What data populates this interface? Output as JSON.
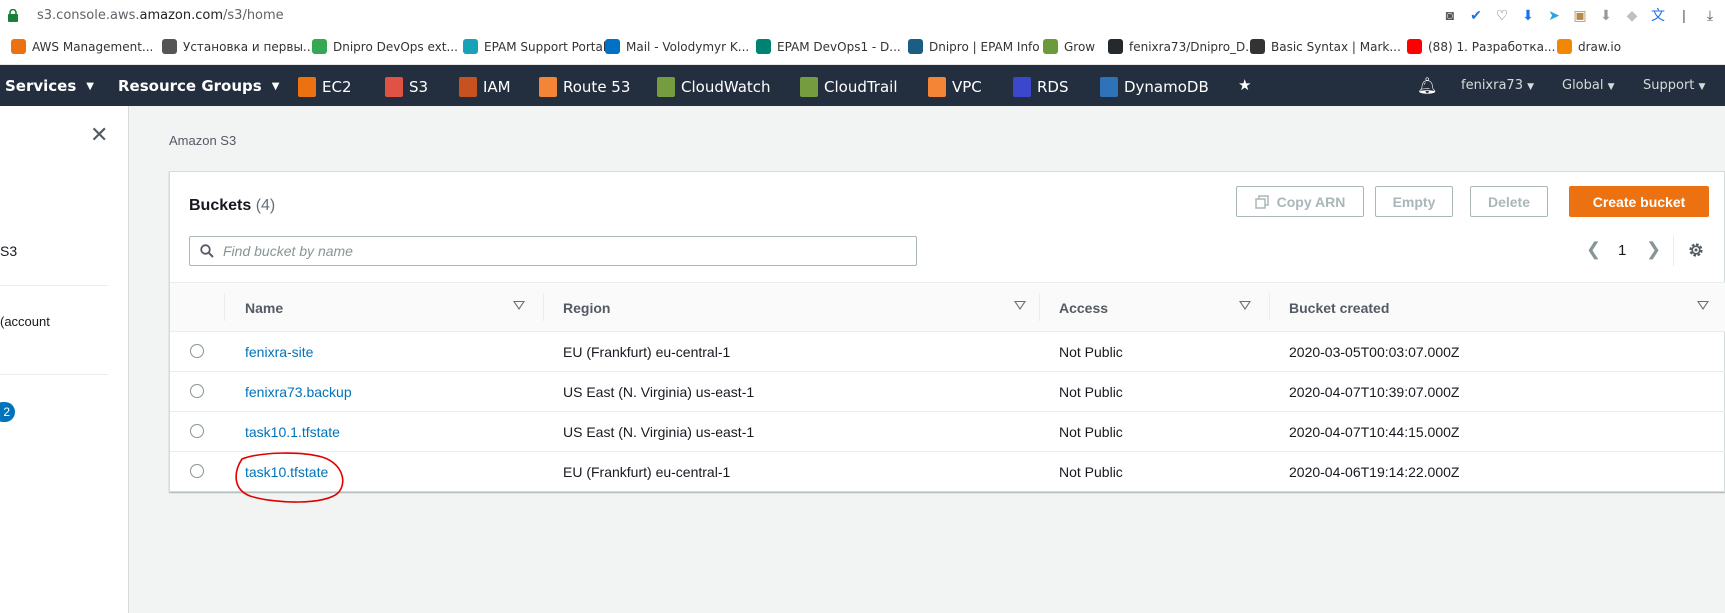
{
  "browser": {
    "url_prefix": "s3.console.aws.",
    "url_domain": "amazon.com",
    "url_path": "/s3/home"
  },
  "bookmarks": [
    {
      "label": "AWS Management...",
      "color": "#ec7211"
    },
    {
      "label": "Установка и первы...",
      "color": "#555555"
    },
    {
      "label": "Dnipro DevOps ext...",
      "color": "#34a853"
    },
    {
      "label": "EPAM Support Portal",
      "color": "#17a2b8"
    },
    {
      "label": "Mail - Volodymyr K...",
      "color": "#0072c6"
    },
    {
      "label": "EPAM DevOps1 - D...",
      "color": "#008272"
    },
    {
      "label": "Dnipro | EPAM Info",
      "color": "#1b5e85"
    },
    {
      "label": "Grow",
      "color": "#6a9a3a"
    },
    {
      "label": "fenixra73/Dnipro_D...",
      "color": "#24292e"
    },
    {
      "label": "Basic Syntax | Mark...",
      "color": "#333333"
    },
    {
      "label": "(88) 1. Разработка...",
      "color": "#ff0000"
    },
    {
      "label": "draw.io",
      "color": "#f08705"
    }
  ],
  "nav": {
    "services": "Services",
    "resource_groups": "Resource Groups",
    "items": [
      {
        "label": "EC2",
        "color": "#ec7211",
        "icon": "ec2-icon"
      },
      {
        "label": "S3",
        "color": "#e05243",
        "icon": "s3-icon"
      },
      {
        "label": "IAM",
        "color": "#c7511f",
        "icon": "iam-icon"
      },
      {
        "label": "Route 53",
        "color": "#f58536",
        "icon": "route53-icon"
      },
      {
        "label": "CloudWatch",
        "color": "#759c3e",
        "icon": "cloudwatch-icon"
      },
      {
        "label": "CloudTrail",
        "color": "#759c3e",
        "icon": "cloudtrail-icon"
      },
      {
        "label": "VPC",
        "color": "#f58536",
        "icon": "vpc-icon"
      },
      {
        "label": "RDS",
        "color": "#3b48cc",
        "icon": "rds-icon"
      },
      {
        "label": "DynamoDB",
        "color": "#2e73b8",
        "icon": "dynamodb-icon"
      }
    ],
    "account": "fenixra73",
    "region": "Global",
    "support": "Support"
  },
  "sidebar": {
    "s3_label": "S3",
    "account_label": "(account",
    "badge": "2"
  },
  "breadcrumb": "Amazon S3",
  "buckets": {
    "title": "Buckets",
    "count": "(4)",
    "copy_arn": "Copy ARN",
    "empty": "Empty",
    "delete": "Delete",
    "create": "Create bucket",
    "search_placeholder": "Find bucket by name",
    "page": "1",
    "columns": [
      "Name",
      "Region",
      "Access",
      "Bucket created"
    ],
    "rows": [
      {
        "name": "fenixra-site",
        "region": "EU (Frankfurt) eu-central-1",
        "access": "Not Public",
        "created": "2020-03-05T00:03:07.000Z"
      },
      {
        "name": "fenixra73.backup",
        "region": "US East (N. Virginia) us-east-1",
        "access": "Not Public",
        "created": "2020-04-07T10:39:07.000Z"
      },
      {
        "name": "task10.1.tfstate",
        "region": "US East (N. Virginia) us-east-1",
        "access": "Not Public",
        "created": "2020-04-07T10:44:15.000Z"
      },
      {
        "name": "task10.tfstate",
        "region": "EU (Frankfurt) eu-central-1",
        "access": "Not Public",
        "created": "2020-04-06T19:14:22.000Z"
      }
    ],
    "accent": "#ec7211",
    "link_color": "#0073bb",
    "annotation_color": "#e00000"
  }
}
